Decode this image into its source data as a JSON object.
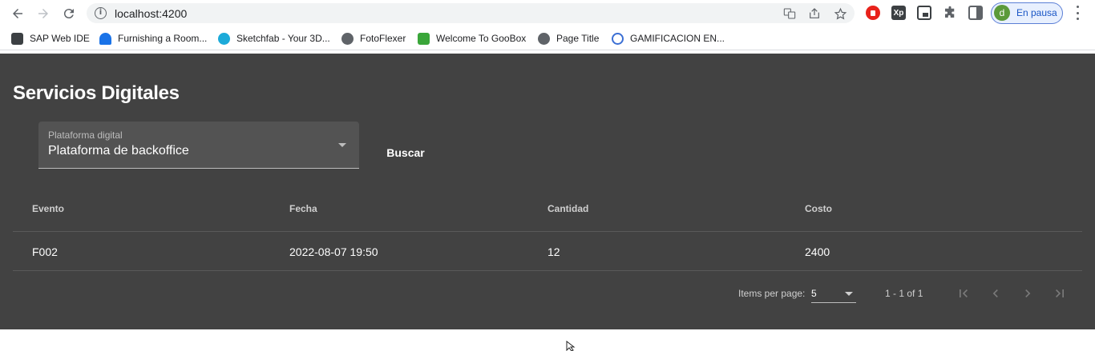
{
  "browser": {
    "url": "localhost:4200",
    "profile_initial": "d",
    "profile_status": "En pausa",
    "extensions": [
      {
        "icon": "adblock-icon",
        "color": "#e8221b",
        "text": ""
      },
      {
        "icon": "xpath-icon",
        "color": "#3c4043",
        "text": "Xp"
      },
      {
        "icon": "picture-in-picture-icon",
        "color": "#3c4043",
        "text": ""
      }
    ]
  },
  "bookmarks": [
    {
      "label": "SAP Web IDE",
      "icon": "sap-icon",
      "color": "#3c4043"
    },
    {
      "label": "Furnishing a Room...",
      "icon": "furniture-icon",
      "color": "#1a73e8"
    },
    {
      "label": "Sketchfab - Your 3D...",
      "icon": "sketchfab-icon",
      "color": "#1caad9"
    },
    {
      "label": "FotoFlexer",
      "icon": "globe-icon",
      "color": "#5f6368"
    },
    {
      "label": "Welcome To GooBox",
      "icon": "goobox-icon",
      "color": "#3aa63a"
    },
    {
      "label": "Page Title",
      "icon": "globe-icon",
      "color": "#5f6368"
    },
    {
      "label": "GAMIFICACION EN...",
      "icon": "gamification-icon",
      "color": "#3b6fd4"
    }
  ],
  "app": {
    "title": "Servicios Digitales",
    "platform_field": {
      "label": "Plataforma digital",
      "value": "Plataforma de backoffice"
    },
    "search_label": "Buscar",
    "table": {
      "columns": [
        "Evento",
        "Fecha",
        "Cantidad",
        "Costo"
      ],
      "rows": [
        [
          "F002",
          "2022-08-07 19:50",
          "12",
          "2400"
        ]
      ]
    },
    "paginator": {
      "items_per_page_label": "Items per page:",
      "page_size": "5",
      "range_label": "1 - 1 of 1"
    }
  }
}
